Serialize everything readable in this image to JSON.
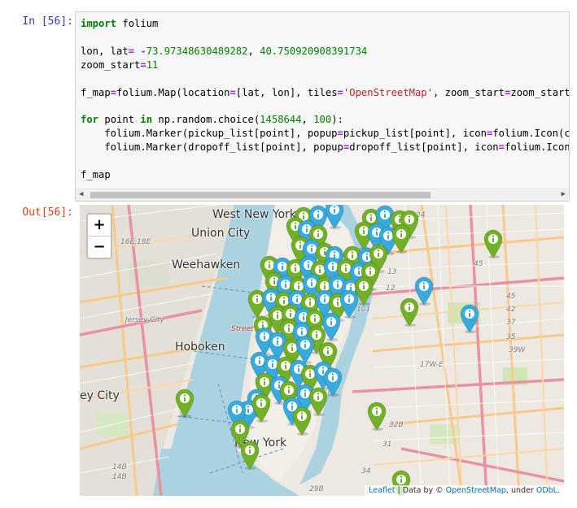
{
  "cell": {
    "in_prompt": "In [56]:",
    "out_prompt": "Out[56]:",
    "code": {
      "l1_kw": "import",
      "l1_rest": " folium",
      "l3_a": "lon, lat",
      "l3_eq": "=",
      "l3_sp": " ",
      "l3_minus": "-",
      "l3_lon": "73.97348630489282",
      "l3_comma": ", ",
      "l3_lat": "40.750920908391734",
      "l4_a": "zoom_start",
      "l4_eq": "=",
      "l4_val": "11",
      "l6_a": "f_map",
      "l6_eq": "=",
      "l6_b": "folium.Map(location",
      "l6_eq2": "=",
      "l6_c": "[lat, lon], tiles",
      "l6_eq3": "=",
      "l6_str": "'OpenStreetMap'",
      "l6_d": ", zoom_start",
      "l6_eq4": "=",
      "l6_e": "zoom_start)",
      "l8_for": "for",
      "l8_a": " point ",
      "l8_in": "in",
      "l8_b": " np.random.choice(",
      "l8_n1": "1458644",
      "l8_c": ", ",
      "l8_n2": "100",
      "l8_d": "):",
      "l9_a": "    folium.Marker(pickup_list[point], popup",
      "l9_eq": "=",
      "l9_b": "pickup_list[point], icon",
      "l9_eq2": "=",
      "l9_c": "folium.Icon(color",
      "l10_a": "    folium.Marker(dropoff_list[point], popup",
      "l10_eq": "=",
      "l10_b": "dropoff_list[point], icon",
      "l10_eq2": "=",
      "l10_c": "folium.Icon(col",
      "l12": "f_map"
    }
  },
  "map": {
    "zoom_in": "+",
    "zoom_out": "−",
    "attribution": {
      "leaflet": "Leaflet",
      "sep": " | Data by © ",
      "osm": "OpenStreetMap",
      "under": ", under ",
      "odbl": "ODbL."
    },
    "labels": {
      "west_new_york": "West New York",
      "union_city": "Union City",
      "weehawken": "Weehawken",
      "hoboken": "Hoboken",
      "jersey_city": "ey City",
      "new_york": "New York",
      "jersey_city_small": "Jersey City",
      "route_16e": "16E;18E",
      "route_14b": "14B",
      "route_14b2": "14B",
      "route_13": "13",
      "route_12": "12",
      "route_101": "101",
      "route_45": "45",
      "route_45b": "45",
      "route_42": "42",
      "route_37": "37",
      "route_35": "35",
      "route_39w": "39W",
      "route_17we": "17W-E",
      "route_32b": "32B",
      "route_31": "31",
      "route_34": "34",
      "route_29b": "29B",
      "route_24": "24",
      "route_red": "Street H"
    },
    "marker_colors": {
      "green": "#72b026",
      "blue": "#38aadd"
    },
    "marker_icon": "info-icon"
  }
}
